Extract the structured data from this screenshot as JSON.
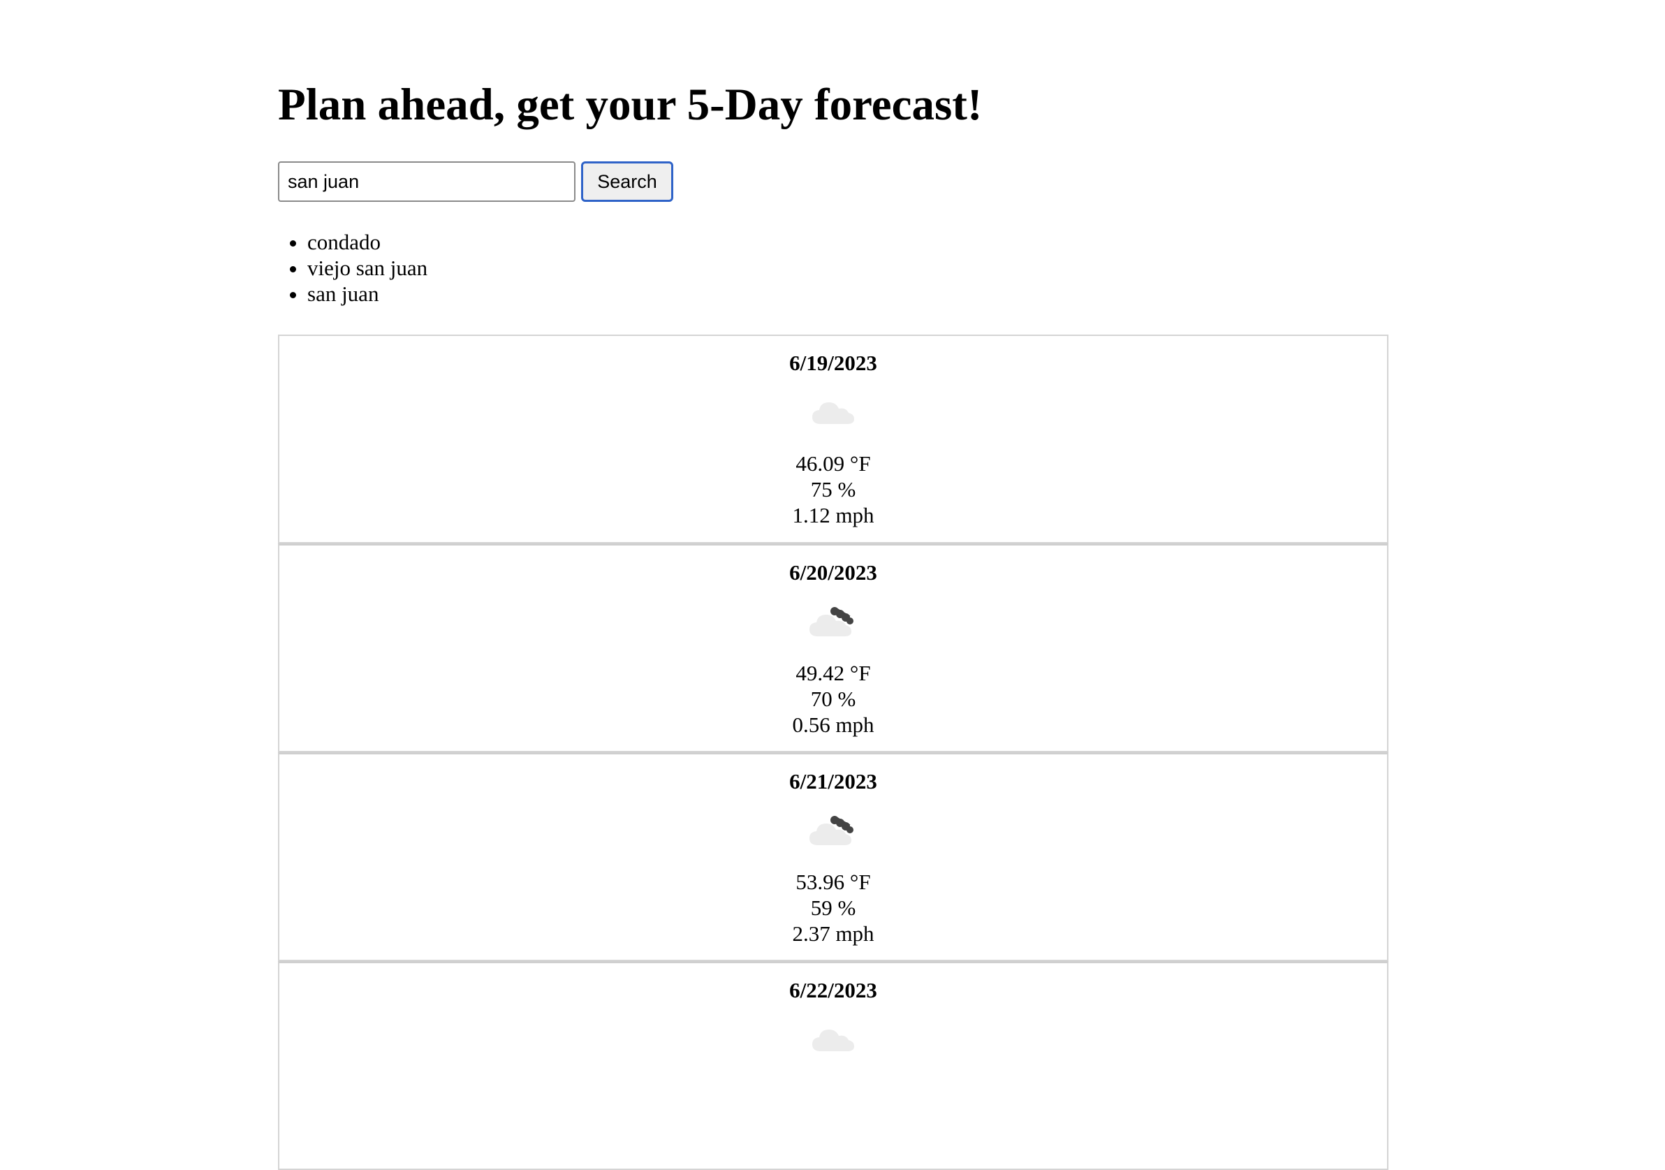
{
  "header": {
    "title": "Plan ahead, get your 5-Day forecast!"
  },
  "search": {
    "value": "san juan",
    "button_label": "Search"
  },
  "history": [
    "condado",
    "viejo san juan",
    "san juan"
  ],
  "forecast": [
    {
      "date": "6/19/2023",
      "icon": "cloud-icon",
      "temp": "46.09 °F",
      "humidity": "75 %",
      "wind": "1.12 mph"
    },
    {
      "date": "6/20/2023",
      "icon": "broken-clouds-icon",
      "temp": "49.42 °F",
      "humidity": "70 %",
      "wind": "0.56 mph"
    },
    {
      "date": "6/21/2023",
      "icon": "broken-clouds-icon",
      "temp": "53.96 °F",
      "humidity": "59 %",
      "wind": "2.37 mph"
    },
    {
      "date": "6/22/2023",
      "icon": "cloud-icon"
    }
  ]
}
